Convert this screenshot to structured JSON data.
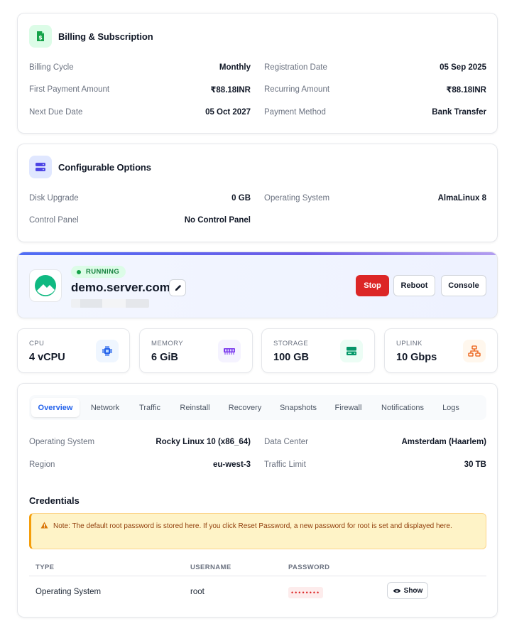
{
  "billing": {
    "title": "Billing & Subscription",
    "rows": [
      {
        "left_label": "Billing Cycle",
        "left_value": "Monthly",
        "right_label": "Registration Date",
        "right_value": "05 Sep 2025"
      },
      {
        "left_label": "First Payment Amount",
        "left_value": "₹88.18INR",
        "right_label": "Recurring Amount",
        "right_value": "₹88.18INR"
      },
      {
        "left_label": "Next Due Date",
        "left_value": "05 Oct 2027",
        "right_label": "Payment Method",
        "right_value": "Bank Transfer"
      }
    ]
  },
  "config": {
    "title": "Configurable Options",
    "rows": [
      {
        "left_label": "Disk Upgrade",
        "left_value": "0 GB",
        "right_label": "Operating System",
        "right_value": "AlmaLinux 8"
      },
      {
        "left_label": "Control Panel",
        "left_value": "No Control Panel"
      }
    ]
  },
  "server": {
    "status": "RUNNING",
    "hostname": "demo.server.com",
    "buttons": {
      "stop": "Stop",
      "reboot": "Reboot",
      "console": "Console"
    }
  },
  "stats": [
    {
      "label": "CPU",
      "value": "4 vCPU",
      "icon": "cpu-icon"
    },
    {
      "label": "MEMORY",
      "value": "6 GiB",
      "icon": "memory-icon"
    },
    {
      "label": "STORAGE",
      "value": "100 GB",
      "icon": "storage-icon"
    },
    {
      "label": "UPLINK",
      "value": "10 Gbps",
      "icon": "network-icon"
    }
  ],
  "tabs": [
    "Overview",
    "Network",
    "Traffic",
    "Reinstall",
    "Recovery",
    "Snapshots",
    "Firewall",
    "Notifications",
    "Logs"
  ],
  "active_tab": "Overview",
  "overview": {
    "rows": [
      {
        "left_label": "Operating System",
        "left_value": "Rocky Linux 10 (x86_64)",
        "right_label": "Data Center",
        "right_value": "Amsterdam (Haarlem)"
      },
      {
        "left_label": "Region",
        "left_value": "eu-west-3",
        "right_label": "Traffic Limit",
        "right_value": "30 TB"
      }
    ]
  },
  "credentials": {
    "title": "Credentials",
    "note": "Note: The default root password is stored here. If you click Reset Password, a new password for root is set and displayed here.",
    "headers": {
      "type": "TYPE",
      "username": "USERNAME",
      "password": "PASSWORD"
    },
    "row": {
      "type": "Operating System",
      "username": "root",
      "password": "••••••••"
    },
    "show_label": "Show"
  },
  "colors": {
    "accent": "#2563eb",
    "running": "#16a34a",
    "stop": "#dc2626",
    "warning": "#f59e0b"
  }
}
